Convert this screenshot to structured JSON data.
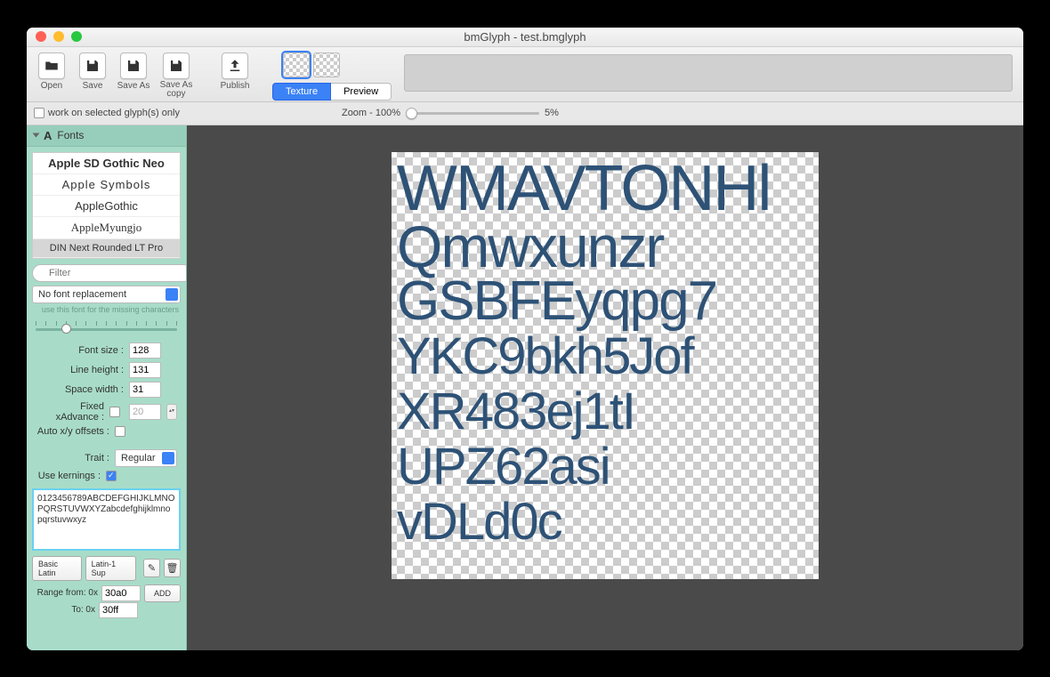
{
  "window": {
    "title": "bmGlyph - test.bmglyph"
  },
  "toolbar": {
    "open": "Open",
    "save": "Save",
    "save_as": "Save As",
    "save_as_copy": "Save As\ncopy",
    "publish": "Publish"
  },
  "tabs": {
    "texture": "Texture",
    "preview": "Preview",
    "active": "texture"
  },
  "subbar": {
    "work_on_selected": "work on selected glyph(s) only",
    "zoom_label": "Zoom - 100%",
    "zoom_pct": "5%"
  },
  "sidebar": {
    "header": "Fonts",
    "fonts": [
      "Apple SD Gothic Neo",
      "Apple Symbols",
      "AppleGothic",
      "AppleMyungjo",
      "DIN Next Rounded LT Pro"
    ],
    "selected_font_index": 4,
    "filter_placeholder": "Filter",
    "replacement": "No font replacement",
    "replacement_hint": "use this font for the missing characters",
    "font_size_label": "Font size :",
    "font_size": "128",
    "line_height_label": "Line height :",
    "line_height": "131",
    "space_width_label": "Space width :",
    "space_width": "31",
    "fixed_xadvance_label": "Fixed xAdvance :",
    "fixed_xadvance": "20",
    "auto_offsets_label": "Auto x/y offsets :",
    "trait_label": "Trait :",
    "trait": "Regular",
    "use_kernings_label": "Use kernings :",
    "characters": "0123456789ABCDEFGHIJKLMNOPQRSTUVWXYZabcdefghijklmnopqrstuvwxyz",
    "basic_latin": "Basic Latin",
    "latin1_sup": "Latin-1 Sup",
    "range_from_label": "Range from: 0x",
    "range_from": "30a0",
    "range_to_label": "To: 0x",
    "range_to": "30ff",
    "add": "ADD"
  },
  "canvas": {
    "lines": [
      "WMAVTONHl",
      "Qmwxunzr",
      "GSBFEyqpg7",
      "YKC9bkh5Jof",
      "XR483ej1tI",
      "UPZ62asi",
      "vDLd0c"
    ]
  }
}
